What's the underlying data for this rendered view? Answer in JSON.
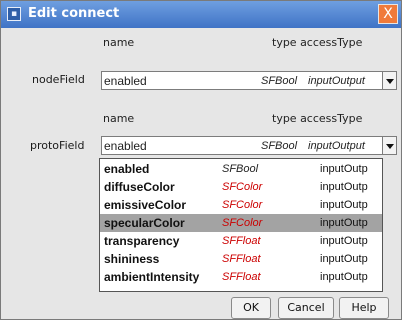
{
  "window": {
    "title": "Edit connect",
    "title_icon": "document-icon",
    "close_glyph": "X"
  },
  "headers": {
    "name": "name",
    "type_access": "type accessType"
  },
  "node_field": {
    "label": "nodeField",
    "name": "enabled",
    "type": "SFBool",
    "access": "inputOutput"
  },
  "proto_field": {
    "label": "protoField",
    "name": "enabled",
    "type": "SFBool",
    "access": "inputOutput"
  },
  "dropdown": {
    "items": [
      {
        "name": "enabled",
        "type": "SFBool",
        "access": "inputOutp",
        "selected": false
      },
      {
        "name": "diffuseColor",
        "type": "SFColor",
        "access": "inputOutp",
        "selected": false
      },
      {
        "name": "emissiveColor",
        "type": "SFColor",
        "access": "inputOutp",
        "selected": false
      },
      {
        "name": "specularColor",
        "type": "SFColor",
        "access": "inputOutp",
        "selected": true
      },
      {
        "name": "transparency",
        "type": "SFFloat",
        "access": "inputOutp",
        "selected": false
      },
      {
        "name": "shininess",
        "type": "SFFloat",
        "access": "inputOutp",
        "selected": false
      },
      {
        "name": "ambientIntensity",
        "type": "SFFloat",
        "access": "inputOutp",
        "selected": false
      }
    ]
  },
  "buttons": {
    "ok": "OK",
    "cancel": "Cancel",
    "help": "Help"
  },
  "colors": {
    "titlebar": "#3f73c6",
    "field_type": "#cc0000",
    "selection": "#a3a3a3",
    "close": "#f07a3a"
  }
}
